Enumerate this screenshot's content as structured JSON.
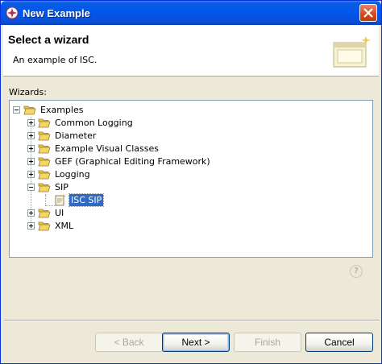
{
  "window": {
    "title": "New Example"
  },
  "banner": {
    "title": "Select a wizard",
    "description": "An example of ISC."
  },
  "wizards_label": "Wizards:",
  "tree": {
    "root": {
      "label": "Examples",
      "expanded": true
    },
    "items": [
      {
        "label": "Common Logging",
        "expanded": false
      },
      {
        "label": "Diameter",
        "expanded": false
      },
      {
        "label": "Example Visual Classes",
        "expanded": false
      },
      {
        "label": "GEF (Graphical Editing Framework)",
        "expanded": false
      },
      {
        "label": "Logging",
        "expanded": false
      },
      {
        "label": "SIP",
        "expanded": true
      },
      {
        "label": "ISC SIP",
        "selected": true
      },
      {
        "label": "UI",
        "expanded": false
      },
      {
        "label": "XML",
        "expanded": false
      }
    ]
  },
  "help": {
    "glyph": "?"
  },
  "buttons": {
    "back": "< Back",
    "next": "Next >",
    "finish": "Finish",
    "cancel": "Cancel"
  },
  "colors": {
    "selection": "#316ac5",
    "titlebar": "#0058ee",
    "folder": "#f5d66b"
  }
}
